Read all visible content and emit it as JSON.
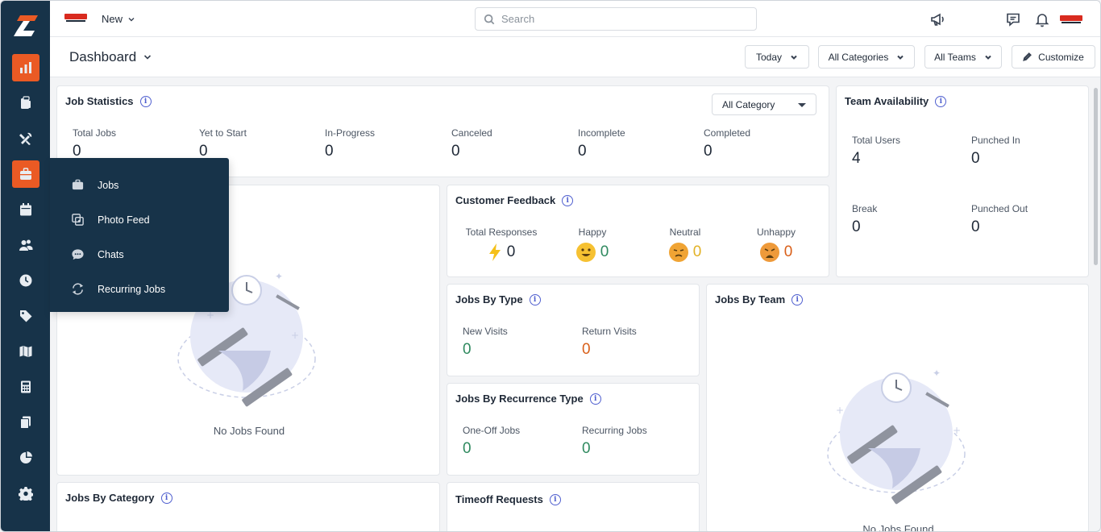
{
  "topbar": {
    "new_label": "New",
    "search_placeholder": "Search"
  },
  "subheader": {
    "title": "Dashboard",
    "filters": {
      "date": "Today",
      "categories": "All Categories",
      "teams": "All Teams",
      "customize": "Customize"
    }
  },
  "flyout": {
    "items": [
      {
        "label": "Jobs",
        "icon": "briefcase-icon"
      },
      {
        "label": "Photo Feed",
        "icon": "photo-feed-icon"
      },
      {
        "label": "Chats",
        "icon": "chat-icon"
      },
      {
        "label": "Recurring Jobs",
        "icon": "recurring-icon"
      }
    ]
  },
  "job_statistics": {
    "title": "Job Statistics",
    "category_select": "All Category",
    "stats": [
      {
        "label": "Total Jobs",
        "value": "0"
      },
      {
        "label": "Yet to Start",
        "value": "0"
      },
      {
        "label": "In-Progress",
        "value": "0"
      },
      {
        "label": "Canceled",
        "value": "0"
      },
      {
        "label": "Incomplete",
        "value": "0"
      },
      {
        "label": "Completed",
        "value": "0"
      }
    ]
  },
  "team_availability": {
    "title": "Team Availability",
    "stats": [
      {
        "label": "Total Users",
        "value": "4"
      },
      {
        "label": "Punched In",
        "value": "0"
      },
      {
        "label": "Break",
        "value": "0"
      },
      {
        "label": "Punched Out",
        "value": "0"
      }
    ]
  },
  "customer_feedback": {
    "title": "Customer Feedback",
    "items": [
      {
        "label": "Total Responses",
        "value": "0"
      },
      {
        "label": "Happy",
        "value": "0"
      },
      {
        "label": "Neutral",
        "value": "0"
      },
      {
        "label": "Unhappy",
        "value": "0"
      }
    ]
  },
  "jobs_empty": {
    "text": "No Jobs Found"
  },
  "jobs_by_type": {
    "title": "Jobs By Type",
    "stats": [
      {
        "label": "New Visits",
        "value": "0"
      },
      {
        "label": "Return Visits",
        "value": "0"
      }
    ]
  },
  "jobs_by_recurrence": {
    "title": "Jobs By Recurrence Type",
    "stats": [
      {
        "label": "One-Off Jobs",
        "value": "0"
      },
      {
        "label": "Recurring Jobs",
        "value": "0"
      }
    ]
  },
  "jobs_by_team": {
    "title": "Jobs By Team",
    "empty_text": "No Jobs Found"
  },
  "jobs_by_category": {
    "title": "Jobs By Category"
  },
  "timeoff_requests": {
    "title": "Timeoff Requests"
  },
  "colors": {
    "sidebar": "#173349",
    "accent": "#ea5a24",
    "positive": "#2f8a5f",
    "negative": "#d9601a",
    "neutral": "#e2b226"
  }
}
